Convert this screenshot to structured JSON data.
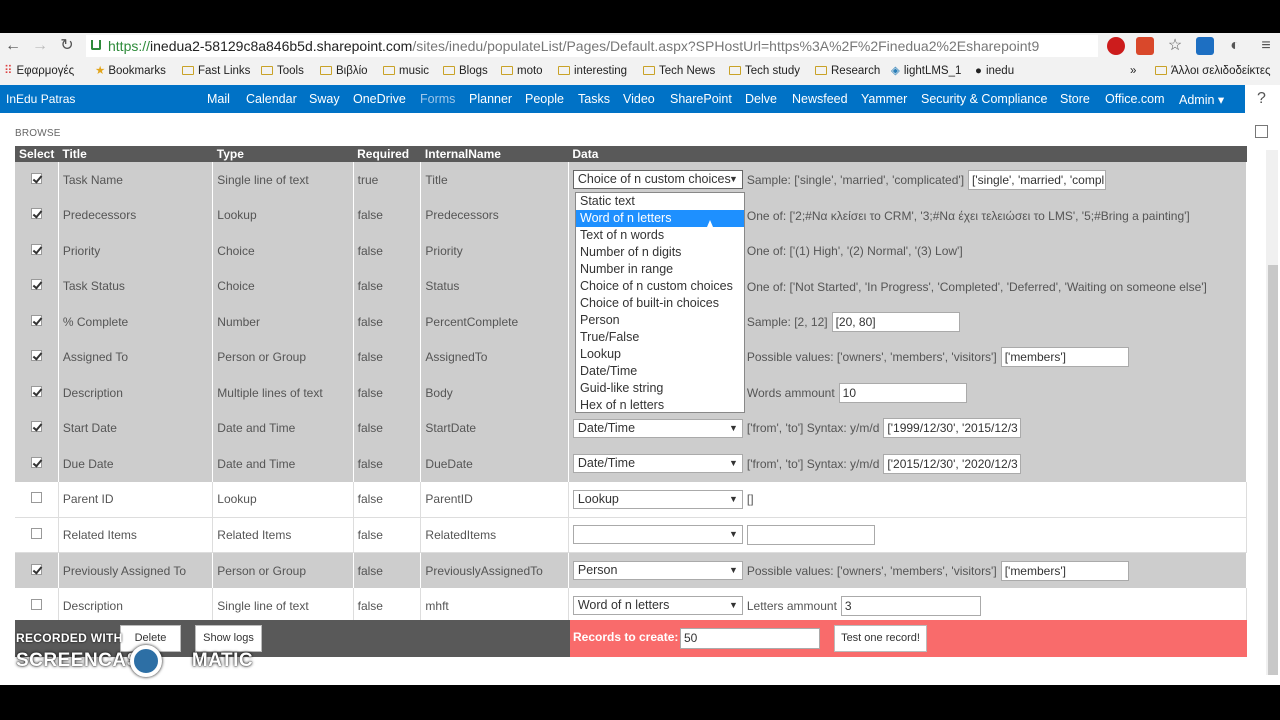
{
  "browser": {
    "url_scheme": "https://",
    "url_host": "inedua2-58129c8a846b5d.sharepoint.com",
    "url_rest": "/sites/inedu/populateList/Pages/Default.aspx?SPHostUrl=https%3A%2F%2Finedua2%2Esharepoint9",
    "bookmarks": [
      {
        "label": "Εφαρμογές",
        "kind": "apps"
      },
      {
        "label": "Bookmarks",
        "kind": "star"
      },
      {
        "label": "Fast Links",
        "kind": "folder"
      },
      {
        "label": "Tools",
        "kind": "folder"
      },
      {
        "label": "Βιβλίο",
        "kind": "folder"
      },
      {
        "label": "music",
        "kind": "folder"
      },
      {
        "label": "Blogs",
        "kind": "folder"
      },
      {
        "label": "moto",
        "kind": "folder"
      },
      {
        "label": "interesting",
        "kind": "folder"
      },
      {
        "label": "Tech News",
        "kind": "folder"
      },
      {
        "label": "Tech study",
        "kind": "folder"
      },
      {
        "label": "Research",
        "kind": "folder"
      },
      {
        "label": "lightLMS_1",
        "kind": "site"
      },
      {
        "label": "inedu",
        "kind": "github"
      }
    ],
    "bookmarks_overflow": "»",
    "other_bookmarks": "Άλλοι σελιδοδείκτες"
  },
  "suitebar": {
    "brand": "InEdu Patras",
    "links": [
      "Mail",
      "Calendar",
      "Sway",
      "OneDrive",
      "Forms",
      "Planner",
      "People",
      "Tasks",
      "Video",
      "SharePoint",
      "Delve",
      "Newsfeed",
      "Yammer",
      "Security & Compliance",
      "Store",
      "Office.com",
      "Admin ▾"
    ],
    "help": "?"
  },
  "ribbon": {
    "browse": "BROWSE"
  },
  "table": {
    "headers": [
      "Select",
      "Title",
      "Type",
      "Required",
      "InternalName",
      "Data"
    ],
    "rows": [
      {
        "checked": true,
        "title": "Task Name",
        "type": "Single line of text",
        "required": "true",
        "internal": "Title",
        "select": "Choice of n custom choices",
        "info": "Sample: ['single', 'married', 'complicated']",
        "input": "['single', 'married', 'compl"
      },
      {
        "checked": true,
        "title": "Predecessors",
        "type": "Lookup",
        "required": "false",
        "internal": "Predecessors",
        "select": "",
        "info": "One of: ['2;#Να κλείσει το CRM', '3;#Να έχει τελειώσει το LMS', '5;#Bring a painting']",
        "input": ""
      },
      {
        "checked": true,
        "title": "Priority",
        "type": "Choice",
        "required": "false",
        "internal": "Priority",
        "select": "",
        "info": "One of: ['(1) High', '(2) Normal', '(3) Low']",
        "input": ""
      },
      {
        "checked": true,
        "title": "Task Status",
        "type": "Choice",
        "required": "false",
        "internal": "Status",
        "select": "",
        "info": "One of: ['Not Started', 'In Progress', 'Completed', 'Deferred', 'Waiting on someone else']",
        "input": ""
      },
      {
        "checked": true,
        "title": "% Complete",
        "type": "Number",
        "required": "false",
        "internal": "PercentComplete",
        "select": "",
        "info": "Sample: [2, 12]",
        "input": "[20, 80]"
      },
      {
        "checked": true,
        "title": "Assigned To",
        "type": "Person or Group",
        "required": "false",
        "internal": "AssignedTo",
        "select": "",
        "info": "Possible values: ['owners', 'members', 'visitors']",
        "input": "['members']"
      },
      {
        "checked": true,
        "title": "Description",
        "type": "Multiple lines of text",
        "required": "false",
        "internal": "Body",
        "select": "",
        "info": "Words ammount",
        "input": "10"
      },
      {
        "checked": true,
        "title": "Start Date",
        "type": "Date and Time",
        "required": "false",
        "internal": "StartDate",
        "select": "Date/Time",
        "info": "['from', 'to'] Syntax: y/m/d",
        "input": "['1999/12/30', '2015/12/3"
      },
      {
        "checked": true,
        "title": "Due Date",
        "type": "Date and Time",
        "required": "false",
        "internal": "DueDate",
        "select": "Date/Time",
        "info": "['from', 'to'] Syntax: y/m/d",
        "input": "['2015/12/30', '2020/12/3"
      },
      {
        "checked": false,
        "title": "Parent ID",
        "type": "Lookup",
        "required": "false",
        "internal": "ParentID",
        "select": "Lookup",
        "info": "[]",
        "input": ""
      },
      {
        "checked": false,
        "title": "Related Items",
        "type": "Related Items",
        "required": "false",
        "internal": "RelatedItems",
        "select": "",
        "info": "",
        "input": " "
      },
      {
        "checked": true,
        "title": "Previously Assigned To",
        "type": "Person or Group",
        "required": "false",
        "internal": "PreviouslyAssignedTo",
        "select": "Person",
        "info": "Possible values: ['owners', 'members', 'visitors']",
        "input": "['members']"
      },
      {
        "checked": false,
        "title": "Description",
        "type": "Single line of text",
        "required": "false",
        "internal": "mhft",
        "select": "Word of n letters",
        "info": "Letters ammount",
        "input": "3"
      }
    ]
  },
  "dropdown": {
    "options": [
      "Static text",
      "Word of n letters",
      "Text of n words",
      "Number of n digits",
      "Number in range",
      "Choice of n custom choices",
      "Choice of built-in choices",
      "Person",
      "True/False",
      "Lookup",
      "Date/Time",
      "Guid-like string",
      "Hex of n letters"
    ],
    "highlighted": "Word of n letters"
  },
  "footer": {
    "delete_label": "Delete",
    "logs_label": "Show logs",
    "records_label": "Records to create:",
    "records_value": "50",
    "test_label": "Test one record!"
  },
  "watermark": {
    "line1": "RECORDED WITH",
    "line2": "SCREENCAST",
    "line3": "MATIC"
  },
  "colors": {
    "suitebar": "#0072c6",
    "header": "#595959",
    "footer_right": "#f96b6b",
    "selected_row": "#cdcdcd"
  }
}
